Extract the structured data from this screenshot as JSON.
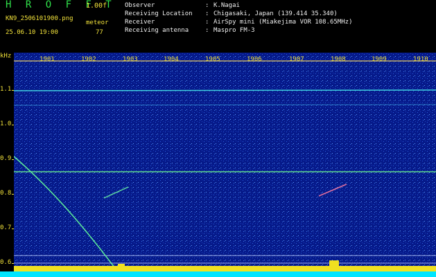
{
  "header": {
    "logo": "H R O F F T",
    "version": "1.00f",
    "filename": "KN9_2506101900.png",
    "meteor_label": "meteor",
    "datetime": "25.06.10 19:00",
    "meteor_count": "77",
    "info_rows": [
      {
        "key": "Observer",
        "sep": ":",
        "value": "K.Nagai"
      },
      {
        "key": "Receiving Location",
        "sep": ":",
        "value": "Chigasaki, Japan (139.414 35.340)"
      },
      {
        "key": "Receiver",
        "sep": ":",
        "value": "AirSpy mini (Miakejima VOR 108.65MHz)"
      },
      {
        "key": "Receiving antenna",
        "sep": ":",
        "value": "Maspro FM-3"
      }
    ]
  },
  "y_axis": {
    "unit": "kHz",
    "ticks": [
      "1.1",
      "1.0",
      "0.9",
      "0.8",
      "0.7",
      "0.6"
    ]
  },
  "time_labels": [
    "1901",
    "1902",
    "1903",
    "1904",
    "1905",
    "1906",
    "1907",
    "1908",
    "1909",
    "1910"
  ],
  "colors": {
    "background": "#061a8a",
    "label": "#f2e23a",
    "logo": "#2fe04a",
    "bottom_band": "#00e5ff"
  }
}
